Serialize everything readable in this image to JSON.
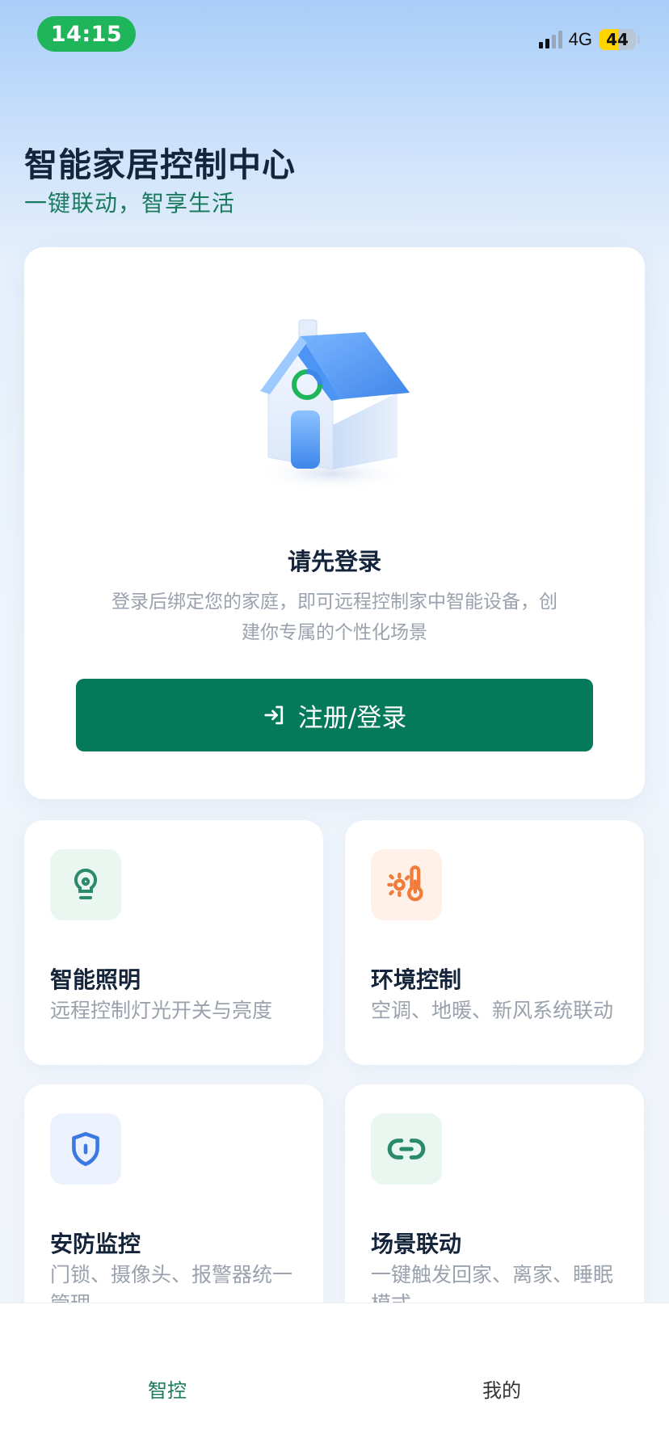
{
  "status_bar": {
    "time": "14:15",
    "network": "4G",
    "battery": "44"
  },
  "header": {
    "title": "智能家居控制中心",
    "subtitle": "一键联动，智享生活"
  },
  "login_card": {
    "illustration": "house-icon",
    "title": "请先登录",
    "description": "登录后绑定您的家庭，即可远程控制家中智能设备，创建你专属的个性化场景",
    "button_label": "注册/登录",
    "button_icon": "login-icon"
  },
  "features": [
    {
      "icon": "lightbulb-icon",
      "title": "智能照明",
      "desc": "远程控制灯光开关与亮度"
    },
    {
      "icon": "thermometer-sun-icon",
      "title": "环境控制",
      "desc": "空调、地暖、新风系统联动"
    },
    {
      "icon": "shield-icon",
      "title": "安防监控",
      "desc": "门锁、摄像头、报警器统一管理"
    },
    {
      "icon": "link-icon",
      "title": "场景联动",
      "desc": "一键触发回家、离家、睡眠模式"
    }
  ],
  "bottom_nav": {
    "items": [
      {
        "label": "智控",
        "active": true
      },
      {
        "label": "我的",
        "active": false
      }
    ]
  },
  "colors": {
    "primary": "#057a5b",
    "subtitle": "#1a7a5e",
    "status_pill": "#1fb55a",
    "light_icon": "#2a8a6a",
    "env_icon": "#f07b3a",
    "security_icon": "#3b78e0"
  }
}
